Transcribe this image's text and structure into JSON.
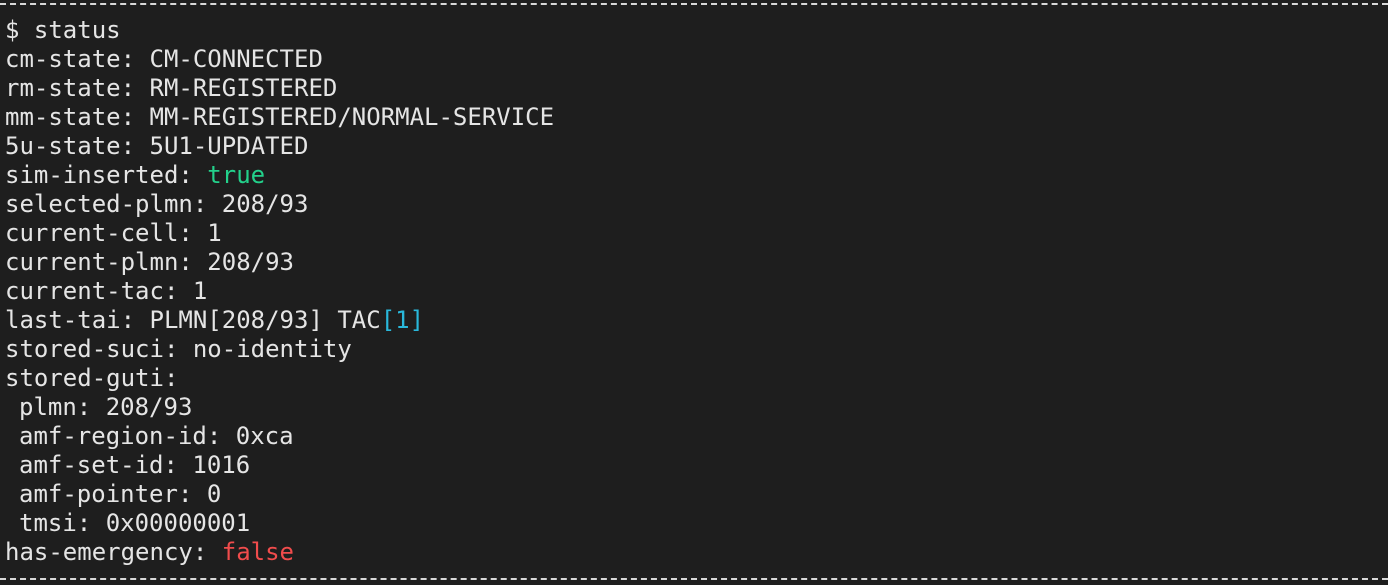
{
  "terminal": {
    "prompt": "$ status",
    "colors": {
      "background": "#1e1e1e",
      "foreground": "#e5e5e5",
      "true_value": "#23d18b",
      "false_value": "#f14c4c",
      "bracket_value": "#29b8db"
    },
    "cm_state": {
      "key": "cm-state: ",
      "value": "CM-CONNECTED"
    },
    "rm_state": {
      "key": "rm-state: ",
      "value": "RM-REGISTERED"
    },
    "mm_state": {
      "key": "mm-state: ",
      "value": "MM-REGISTERED/NORMAL-SERVICE"
    },
    "u5_state": {
      "key": "5u-state: ",
      "value": "5U1-UPDATED"
    },
    "sim_inserted": {
      "key": "sim-inserted: ",
      "value": "true"
    },
    "selected_plmn": {
      "key": "selected-plmn: ",
      "value": "208/93"
    },
    "current_cell": {
      "key": "current-cell: ",
      "value": "1"
    },
    "current_plmn": {
      "key": "current-plmn: ",
      "value": "208/93"
    },
    "current_tac": {
      "key": "current-tac: ",
      "value": "1"
    },
    "last_tai": {
      "key": "last-tai: ",
      "prefix": "PLMN[208/93] TAC",
      "bracket_value": "[1]"
    },
    "stored_suci": {
      "key": "stored-suci: ",
      "value": "no-identity"
    },
    "stored_guti": {
      "key": "stored-guti:",
      "plmn": {
        "key": "plmn: ",
        "value": "208/93"
      },
      "amf_region_id": {
        "key": "amf-region-id: ",
        "value": "0xca"
      },
      "amf_set_id": {
        "key": "amf-set-id: ",
        "value": "1016"
      },
      "amf_pointer": {
        "key": "amf-pointer: ",
        "value": "0"
      },
      "tmsi": {
        "key": "tmsi: ",
        "value": "0x00000001"
      }
    },
    "has_emergency": {
      "key": "has-emergency: ",
      "value": "false"
    }
  }
}
